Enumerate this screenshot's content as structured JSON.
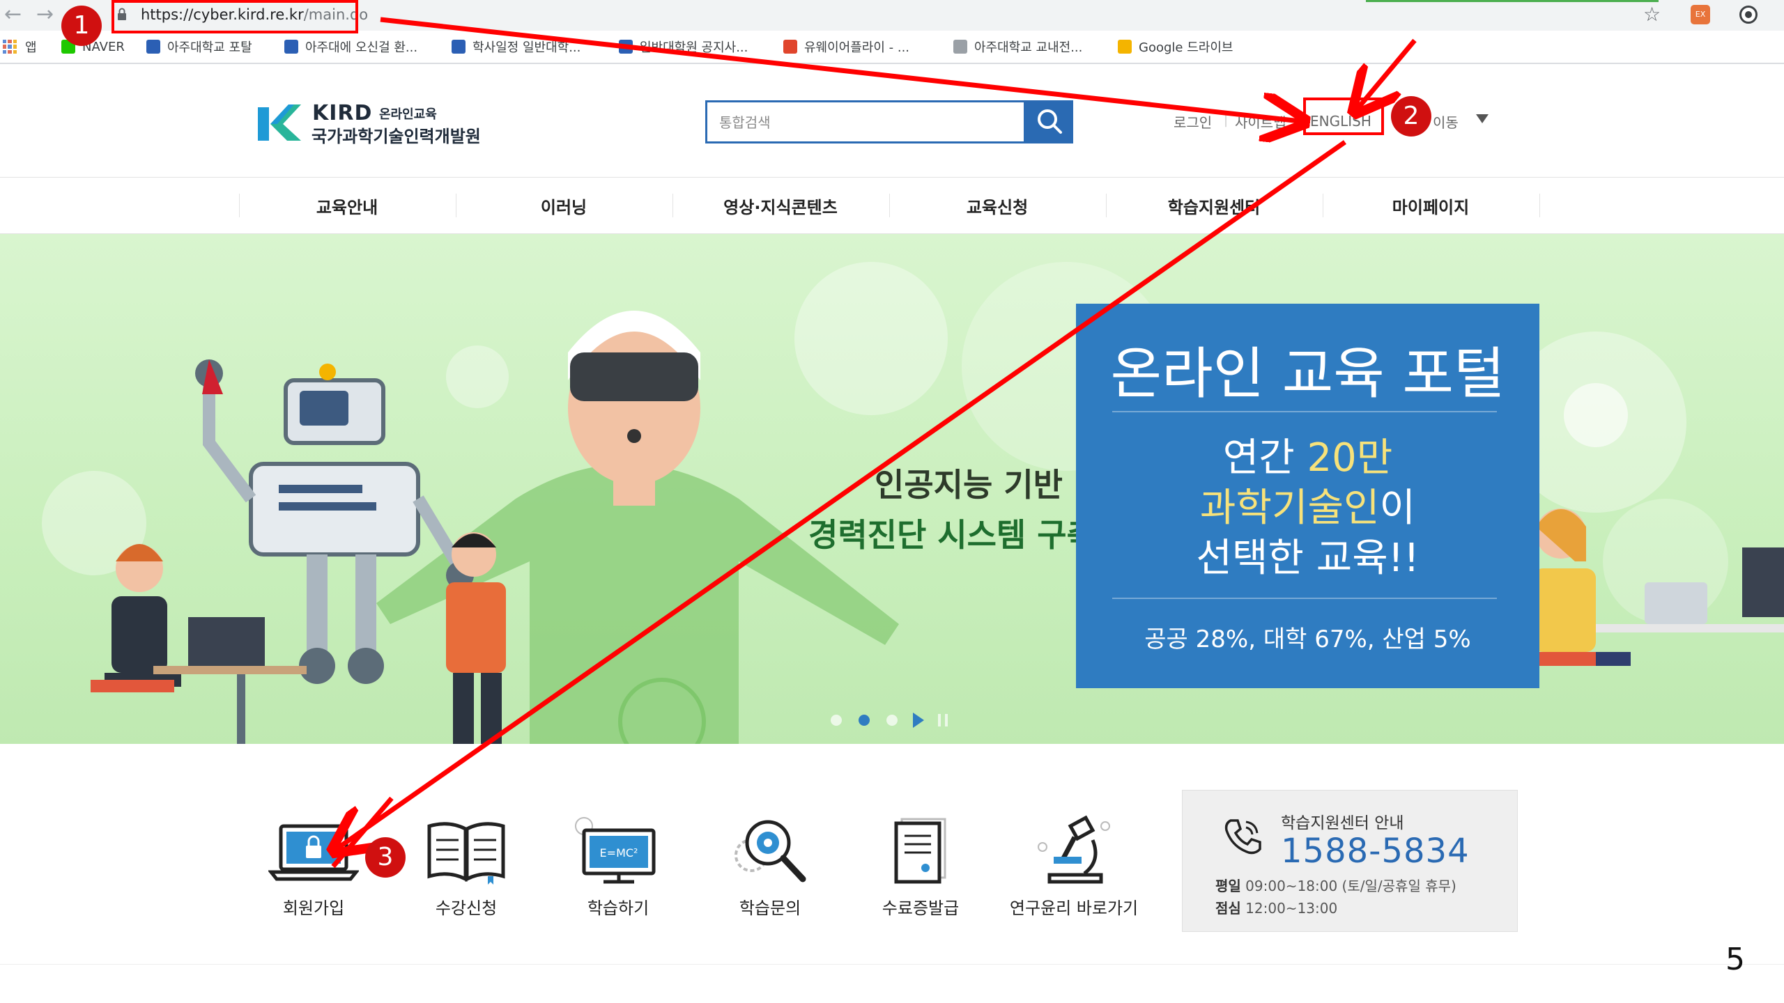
{
  "browser": {
    "url_host": "https://cyber.kird.re.kr",
    "url_path": "/main.do",
    "bookmarks": [
      {
        "label": "앱",
        "color": "#5f8bd6"
      },
      {
        "label": "NAVER",
        "color": "#1ec800"
      },
      {
        "label": "아주대학교 포탈",
        "color": "#2b5fb4"
      },
      {
        "label": "아주대에 오신걸 환...",
        "color": "#2b5fb4"
      },
      {
        "label": "학사일정 일반대학...",
        "color": "#2b5fb4"
      },
      {
        "label": "일반대학원 공지사...",
        "color": "#2b5fb4"
      },
      {
        "label": "유웨이어플라이 - ...",
        "color": "#e0452c"
      },
      {
        "label": "아주대학교 교내전...",
        "color": "#9aa0a6"
      },
      {
        "label": "Google 드라이브",
        "color": "#f4b400"
      }
    ]
  },
  "header": {
    "logo": {
      "brand": "KIRD",
      "tagline": "온라인교육",
      "org_name": "국가과학기술인력개발원"
    },
    "search": {
      "placeholder": "통합검색"
    },
    "util_links": {
      "login": "로그인",
      "sitemap": "사이트맵",
      "english": "ENGLISH",
      "move": "이동"
    }
  },
  "nav": {
    "items": [
      "교육안내",
      "이러닝",
      "영상·지식콘텐츠",
      "교육신청",
      "학습지원센터",
      "마이페이지"
    ]
  },
  "banner": {
    "caption_line1": "인공지능 기반",
    "caption_line2": "경력진단 시스템 구축",
    "promo": {
      "title": "온라인 교육 포털",
      "line1_a": "연간 ",
      "line1_hl": "20만",
      "line2_hl": "과학기술인",
      "line2_b": "이",
      "line3": "선택한 교육!!",
      "stats": "공공 28%, 대학 67%, 산업 5%"
    },
    "slide_count": 3,
    "active_slide": 2
  },
  "quick_menu": [
    {
      "label": "회원가입",
      "icon": "laptop-lock-icon"
    },
    {
      "label": "수강신청",
      "icon": "open-book-icon"
    },
    {
      "label": "학습하기",
      "icon": "formula-screen-icon"
    },
    {
      "label": "학습문의",
      "icon": "magnifier-gear-icon"
    },
    {
      "label": "수료증발급",
      "icon": "certificate-icon"
    },
    {
      "label": "연구윤리 바로가기",
      "icon": "microscope-icon"
    }
  ],
  "support": {
    "title": "학습지원센터 안내",
    "phone": "1588-5834",
    "weekday_label": "평일",
    "weekday_hours": " 09:00~18:00 (토/일/공휴일 휴무)",
    "lunch_label": "점심",
    "lunch_hours": " 12:00~13:00"
  },
  "annotations": {
    "badges": [
      "1",
      "2",
      "3"
    ],
    "color": "#ff0000"
  },
  "page_number": "5"
}
